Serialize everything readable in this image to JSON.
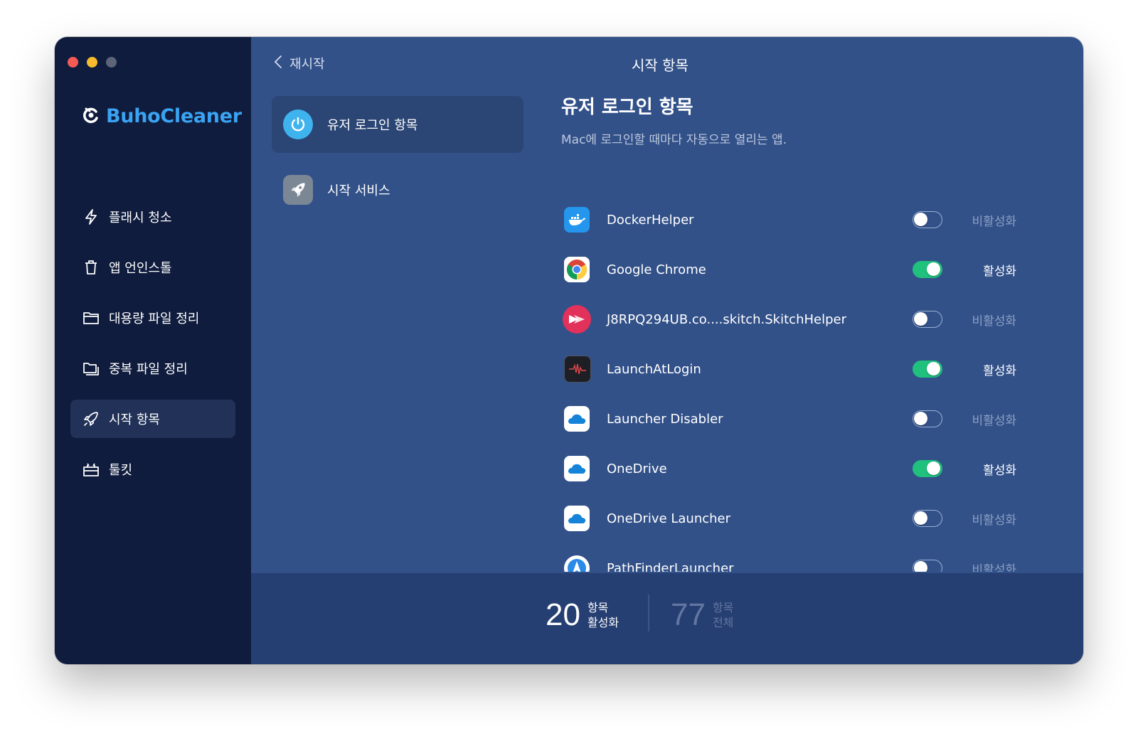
{
  "window": {
    "buttons": [
      "close",
      "minimize",
      "zoom"
    ]
  },
  "brand": {
    "name": "BuhoCleaner",
    "color": "#3aa3f2"
  },
  "sidebar": {
    "items": [
      {
        "label": "플래시 청소",
        "icon": "flash-icon"
      },
      {
        "label": "앱 언인스톨",
        "icon": "trash-icon"
      },
      {
        "label": "대용량 파일 정리",
        "icon": "folder-icon"
      },
      {
        "label": "중복 파일 정리",
        "icon": "duplicate-folder-icon"
      },
      {
        "label": "시작 항목",
        "icon": "rocket-icon",
        "active": true
      },
      {
        "label": "툴킷",
        "icon": "toolkit-icon"
      }
    ]
  },
  "header": {
    "back_label": "재시작",
    "title": "시작 항목"
  },
  "categories": [
    {
      "label": "유저 로그인 항목",
      "icon": "power-icon",
      "active": true
    },
    {
      "label": "시작 서비스",
      "icon": "rocket-icon"
    }
  ],
  "section": {
    "title": "유저 로그인 항목",
    "subtitle": "Mac에 로그인할 때마다 자동으로 열리는 앱."
  },
  "items": [
    {
      "name": "DockerHelper",
      "icon": "docker-icon",
      "enabled": false,
      "status": "비활성화"
    },
    {
      "name": "Google Chrome",
      "icon": "chrome-icon",
      "enabled": true,
      "status": "활성화"
    },
    {
      "name": "J8RPQ294UB.co....skitch.SkitchHelper",
      "icon": "skitch-icon",
      "enabled": false,
      "status": "비활성화"
    },
    {
      "name": "LaunchAtLogin",
      "icon": "waveform-app-icon",
      "enabled": true,
      "status": "활성화"
    },
    {
      "name": "Launcher Disabler",
      "icon": "onedrive-icon",
      "enabled": false,
      "status": "비활성화"
    },
    {
      "name": "OneDrive",
      "icon": "onedrive-icon",
      "enabled": true,
      "status": "활성화"
    },
    {
      "name": "OneDrive Launcher",
      "icon": "onedrive-icon",
      "enabled": false,
      "status": "비활성화"
    },
    {
      "name": "PathFinderLauncher",
      "icon": "pathfinder-icon",
      "enabled": false,
      "status": "비활성화"
    }
  ],
  "footer": {
    "active": {
      "count": "20",
      "label_top": "항목",
      "label_bottom": "활성화"
    },
    "total": {
      "count": "77",
      "label_top": "항목",
      "label_bottom": "전체"
    }
  },
  "colors": {
    "toggle_on": "#20c07d",
    "sidebar_bg": "#0f1c3d",
    "main_bg": "#325189"
  }
}
